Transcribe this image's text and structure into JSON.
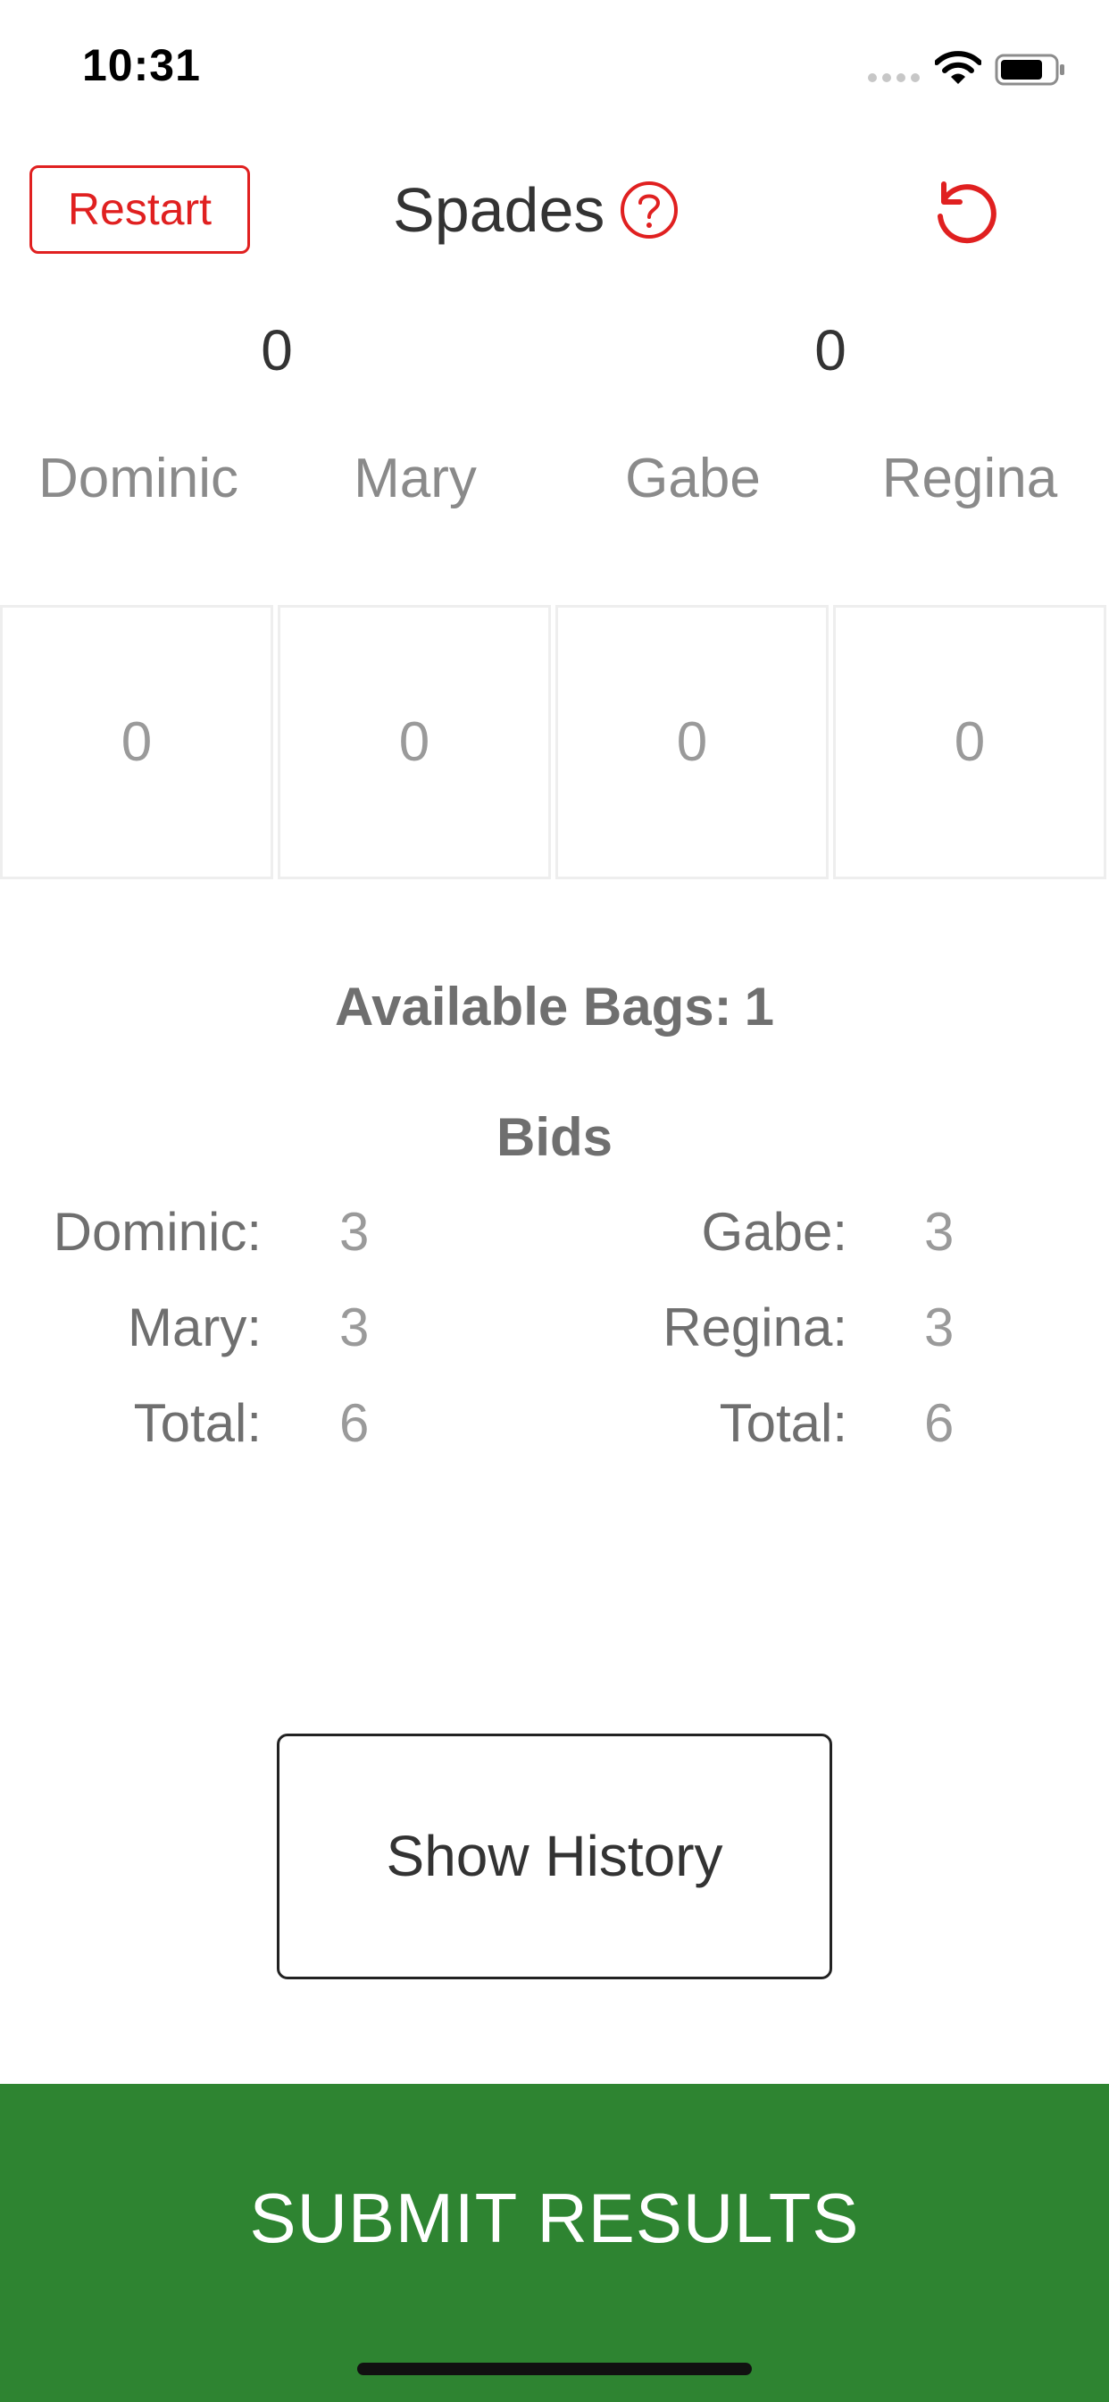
{
  "status_bar": {
    "time": "10:31"
  },
  "header": {
    "restart_label": "Restart",
    "title": "Spades",
    "help_icon": "help-circle-icon",
    "undo_icon": "undo-icon",
    "accent_color": "#e02020"
  },
  "team_scores": [
    "0",
    "0"
  ],
  "players": [
    "Dominic",
    "Mary",
    "Gabe",
    "Regina"
  ],
  "round_scores": [
    "0",
    "0",
    "0",
    "0"
  ],
  "available_bags": {
    "label": "Available Bags:",
    "value": "1"
  },
  "bids": {
    "heading": "Bids",
    "left": [
      {
        "label": "Dominic:",
        "value": "3"
      },
      {
        "label": "Mary:",
        "value": "3"
      },
      {
        "label": "Total:",
        "value": "6"
      }
    ],
    "right": [
      {
        "label": "Gabe:",
        "value": "3"
      },
      {
        "label": "Regina:",
        "value": "3"
      },
      {
        "label": "Total:",
        "value": "6"
      }
    ]
  },
  "show_history_label": "Show History",
  "submit": {
    "label": "SUBMIT RESULTS",
    "color": "#2e8431"
  }
}
